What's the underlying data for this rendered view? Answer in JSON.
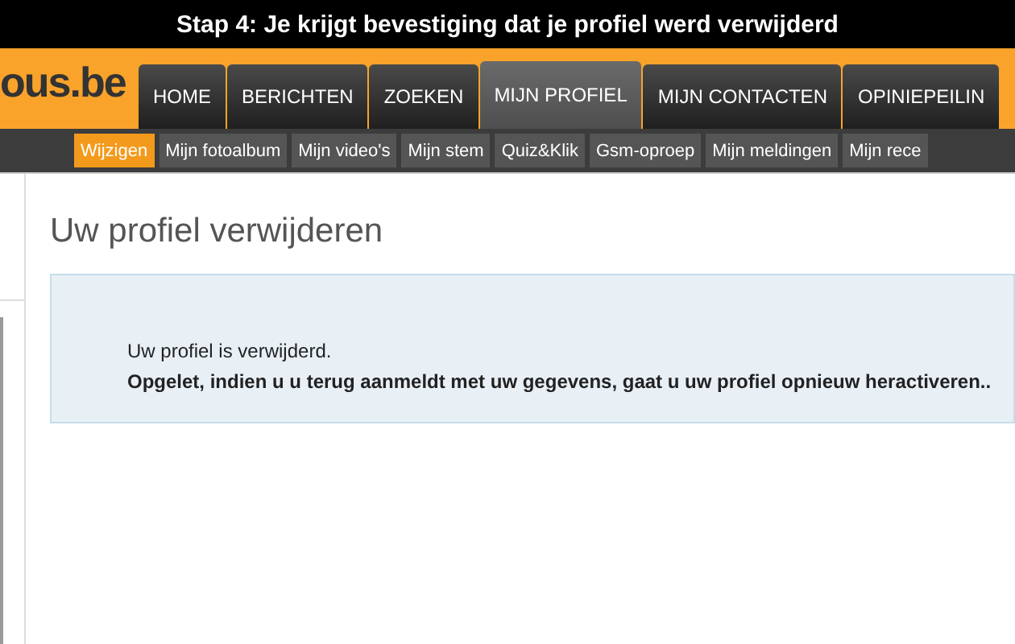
{
  "caption": "Stap 4: Je krijgt bevestiging dat je profiel werd verwijderd",
  "logo": "ous.be",
  "nav_tabs": [
    {
      "label": "HOME",
      "selected": false
    },
    {
      "label": "BERICHTEN",
      "selected": false
    },
    {
      "label": "ZOEKEN",
      "selected": false
    },
    {
      "label": "MIJN PROFIEL",
      "selected": true
    },
    {
      "label": "MIJN CONTACTEN",
      "selected": false
    },
    {
      "label": "OPINIEPEILIN",
      "selected": false
    }
  ],
  "sub_tabs": [
    {
      "label": "Wijzigen",
      "selected": true
    },
    {
      "label": "Mijn fotoalbum",
      "selected": false
    },
    {
      "label": "Mijn video's",
      "selected": false
    },
    {
      "label": "Mijn stem",
      "selected": false
    },
    {
      "label": "Quiz&Klik",
      "selected": false
    },
    {
      "label": "Gsm-oproep",
      "selected": false
    },
    {
      "label": "Mijn meldingen",
      "selected": false
    },
    {
      "label": "Mijn rece",
      "selected": false
    }
  ],
  "page_title": "Uw profiel verwijderen",
  "message": {
    "text": "Uw profiel is verwijderd.",
    "warning": "Opgelet, indien u u terug aanmeldt met uw gegevens, gaat u uw profiel opnieuw heractiveren.."
  }
}
